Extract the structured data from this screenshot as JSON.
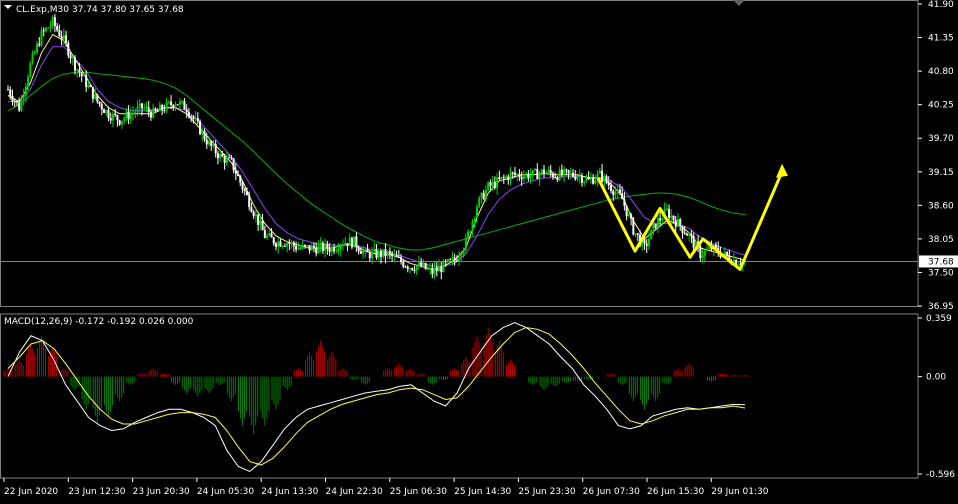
{
  "header": {
    "symbol_label": "CL.Exp,M30",
    "ohlc_text": "37.74 37.80 37.65 37.68"
  },
  "macd_header": {
    "label": "MACD(12,26,9) -0.172 -0.192 0.026 0.000"
  },
  "colors": {
    "background": "#000000",
    "bull_candle": "#00d000",
    "bear_candle": "#ffffff",
    "ma_fast": "#ffff80",
    "ma_slow": "#9040ff",
    "ma_long": "#00b000",
    "macd_hist_pos": "#c00000",
    "macd_hist_neg": "#008000",
    "macd_line": "#ffffff",
    "signal_line": "#ffff40",
    "annotation": "#ffff00",
    "price_line": "#808080"
  },
  "chart_data": [
    {
      "type": "line",
      "title": "CL.Exp,M30",
      "ylim": [
        36.95,
        41.9
      ],
      "y_ticks": [
        "41.90",
        "41.35",
        "40.80",
        "40.25",
        "39.70",
        "39.15",
        "38.60",
        "38.05",
        "37.50",
        "36.95"
      ],
      "current_price": "37.68",
      "x_ticks": [
        "22 Jun 2020",
        "23 Jun 12:30",
        "23 Jun 20:30",
        "24 Jun 05:30",
        "24 Jun 13:30",
        "24 Jun 22:30",
        "25 Jun 06:30",
        "25 Jun 14:30",
        "25 Jun 23:30",
        "26 Jun 07:30",
        "26 Jun 15:30",
        "29 Jun 01:30"
      ],
      "price_path": [
        40.5,
        40.2,
        40.9,
        41.4,
        41.6,
        41.3,
        40.9,
        40.6,
        40.3,
        40.1,
        40.0,
        40.1,
        40.2,
        40.1,
        40.2,
        40.3,
        40.2,
        39.9,
        39.6,
        39.4,
        39.3,
        38.9,
        38.5,
        38.1,
        38.0,
        38.0,
        37.9,
        37.9,
        37.9,
        37.9,
        38.0,
        38.0,
        37.8,
        37.8,
        37.8,
        37.7,
        37.6,
        37.6,
        37.5,
        37.6,
        37.7,
        38.0,
        38.6,
        38.9,
        39.0,
        39.1,
        39.1,
        39.1,
        39.15,
        39.1,
        39.1,
        39.1,
        39.0,
        39.1,
        38.9,
        38.7,
        38.2,
        37.9,
        38.3,
        38.5,
        38.3,
        38.1,
        37.8,
        37.9,
        37.8,
        37.7,
        37.68
      ],
      "ma_fast": [
        40.4,
        40.3,
        40.6,
        41.1,
        41.4,
        41.3,
        41.0,
        40.7,
        40.4,
        40.2,
        40.1,
        40.1,
        40.1,
        40.1,
        40.2,
        40.2,
        40.1,
        39.9,
        39.7,
        39.5,
        39.3,
        39.0,
        38.6,
        38.3,
        38.1,
        38.0,
        37.95,
        37.9,
        37.9,
        37.9,
        37.95,
        37.95,
        37.85,
        37.8,
        37.8,
        37.75,
        37.65,
        37.6,
        37.55,
        37.6,
        37.7,
        37.9,
        38.4,
        38.8,
        39.0,
        39.05,
        39.1,
        39.1,
        39.12,
        39.1,
        39.1,
        39.1,
        39.05,
        39.05,
        38.95,
        38.75,
        38.35,
        38.05,
        38.2,
        38.35,
        38.3,
        38.15,
        37.9,
        37.85,
        37.8,
        37.75,
        37.7
      ],
      "ma_slow": [
        40.3,
        40.3,
        40.5,
        40.9,
        41.2,
        41.2,
        41.0,
        40.8,
        40.5,
        40.3,
        40.2,
        40.15,
        40.15,
        40.15,
        40.2,
        40.2,
        40.15,
        40.0,
        39.8,
        39.6,
        39.4,
        39.15,
        38.85,
        38.55,
        38.3,
        38.15,
        38.05,
        38.0,
        37.95,
        37.95,
        37.95,
        37.95,
        37.9,
        37.85,
        37.82,
        37.78,
        37.72,
        37.66,
        37.6,
        37.6,
        37.65,
        37.8,
        38.1,
        38.45,
        38.7,
        38.85,
        38.95,
        39.0,
        39.05,
        39.05,
        39.07,
        39.08,
        39.06,
        39.05,
        39.0,
        38.88,
        38.65,
        38.4,
        38.3,
        38.3,
        38.3,
        38.22,
        38.08,
        37.98,
        37.9,
        37.84,
        37.78
      ],
      "ma_long": [
        40.15,
        40.25,
        40.4,
        40.55,
        40.68,
        40.75,
        40.78,
        40.78,
        40.76,
        40.74,
        40.72,
        40.7,
        40.68,
        40.65,
        40.6,
        40.52,
        40.4,
        40.25,
        40.1,
        39.95,
        39.8,
        39.65,
        39.48,
        39.3,
        39.12,
        38.95,
        38.8,
        38.65,
        38.52,
        38.4,
        38.28,
        38.18,
        38.08,
        38.0,
        37.95,
        37.9,
        37.87,
        37.87,
        37.9,
        37.95,
        38.0,
        38.05,
        38.1,
        38.15,
        38.2,
        38.25,
        38.3,
        38.35,
        38.4,
        38.45,
        38.5,
        38.55,
        38.6,
        38.65,
        38.7,
        38.73,
        38.76,
        38.78,
        38.8,
        38.8,
        38.78,
        38.73,
        38.66,
        38.58,
        38.52,
        38.47,
        38.45
      ],
      "annotation_zigzag": [
        [
          0,
          39.05
        ],
        [
          1,
          37.85
        ],
        [
          2,
          38.55
        ],
        [
          3,
          37.75
        ],
        [
          4,
          38.05
        ],
        [
          5,
          37.55
        ],
        [
          6,
          39.15
        ]
      ]
    },
    {
      "type": "bar",
      "title": "MACD(12,26,9)",
      "ylim": [
        -0.596,
        0.359
      ],
      "y_ticks": [
        "0.359",
        "0.00",
        "-0.596"
      ],
      "histogram": [
        0.05,
        0.1,
        0.2,
        0.25,
        0.18,
        0.05,
        -0.08,
        -0.2,
        -0.28,
        -0.25,
        -0.15,
        -0.05,
        0.02,
        0.05,
        0.02,
        -0.05,
        -0.1,
        -0.12,
        -0.1,
        -0.05,
        -0.15,
        -0.3,
        -0.35,
        -0.3,
        -0.2,
        -0.08,
        0.05,
        0.15,
        0.22,
        0.15,
        0.05,
        -0.02,
        -0.05,
        0.0,
        0.05,
        0.08,
        0.05,
        0.02,
        -0.05,
        -0.02,
        0.05,
        0.12,
        0.25,
        0.3,
        0.22,
        0.1,
        0.0,
        -0.05,
        -0.08,
        -0.06,
        -0.04,
        -0.03,
        -0.02,
        0.0,
        0.02,
        -0.05,
        -0.15,
        -0.2,
        -0.15,
        -0.05,
        0.05,
        0.08,
        0.0,
        -0.03,
        0.02,
        0.01,
        0.01
      ],
      "macd": [
        0.0,
        0.15,
        0.25,
        0.22,
        0.1,
        -0.05,
        -0.15,
        -0.25,
        -0.3,
        -0.33,
        -0.32,
        -0.28,
        -0.25,
        -0.22,
        -0.2,
        -0.2,
        -0.22,
        -0.25,
        -0.3,
        -0.45,
        -0.55,
        -0.58,
        -0.52,
        -0.42,
        -0.32,
        -0.25,
        -0.2,
        -0.18,
        -0.16,
        -0.14,
        -0.12,
        -0.1,
        -0.09,
        -0.08,
        -0.06,
        -0.05,
        -0.1,
        -0.15,
        -0.18,
        -0.1,
        0.05,
        0.15,
        0.25,
        0.3,
        0.33,
        0.3,
        0.25,
        0.2,
        0.12,
        0.05,
        -0.05,
        -0.12,
        -0.2,
        -0.3,
        -0.32,
        -0.3,
        -0.24,
        -0.22,
        -0.2,
        -0.19,
        -0.2,
        -0.19,
        -0.18,
        -0.17,
        -0.172
      ],
      "signal": [
        0.05,
        0.12,
        0.2,
        0.22,
        0.17,
        0.08,
        -0.02,
        -0.12,
        -0.2,
        -0.26,
        -0.29,
        -0.29,
        -0.27,
        -0.25,
        -0.23,
        -0.22,
        -0.22,
        -0.23,
        -0.25,
        -0.33,
        -0.43,
        -0.52,
        -0.54,
        -0.5,
        -0.43,
        -0.35,
        -0.28,
        -0.24,
        -0.2,
        -0.17,
        -0.15,
        -0.13,
        -0.11,
        -0.1,
        -0.08,
        -0.07,
        -0.08,
        -0.11,
        -0.14,
        -0.13,
        -0.06,
        0.03,
        0.12,
        0.2,
        0.27,
        0.3,
        0.29,
        0.26,
        0.2,
        0.13,
        0.05,
        -0.04,
        -0.12,
        -0.2,
        -0.27,
        -0.29,
        -0.27,
        -0.24,
        -0.22,
        -0.2,
        -0.2,
        -0.19,
        -0.19,
        -0.18,
        -0.192
      ]
    }
  ]
}
